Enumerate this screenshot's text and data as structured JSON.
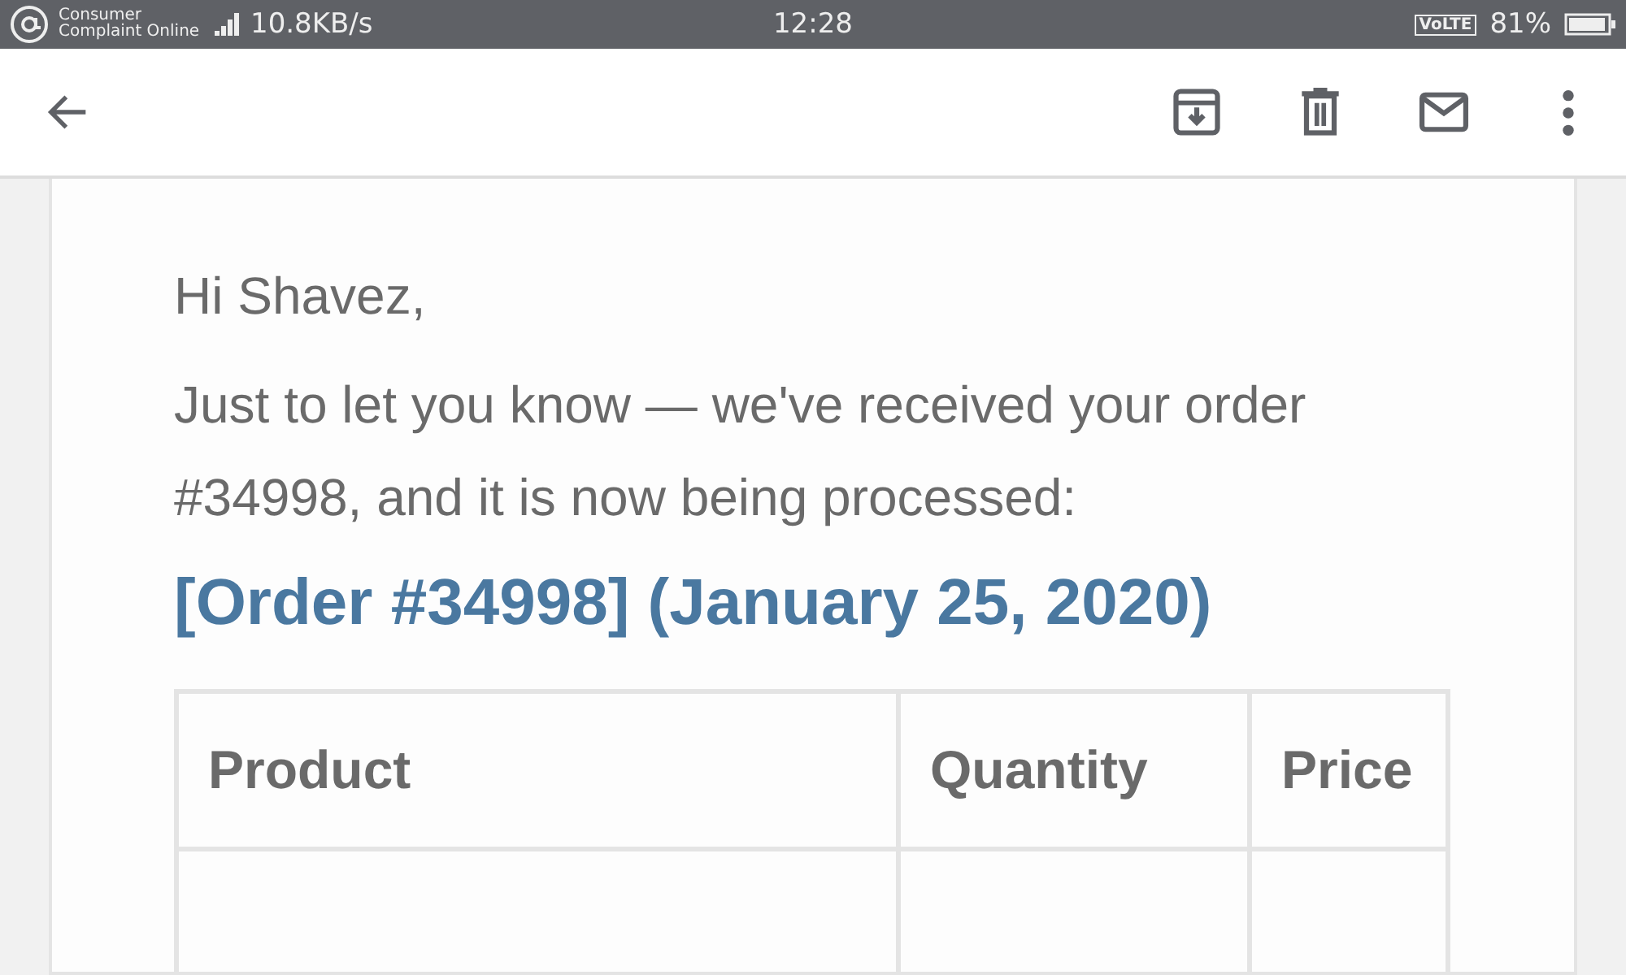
{
  "status_bar": {
    "notification": "Consumer Complaint Online",
    "network_speed": "10.8KB/s",
    "time": "12:28",
    "volte": "VoLTE",
    "battery": "81%"
  },
  "toolbar": {
    "actions": [
      {
        "kind": "archive"
      },
      {
        "kind": "delete"
      },
      {
        "kind": "mail"
      },
      {
        "kind": "more"
      }
    ]
  },
  "email": {
    "greeting": "Hi Shavez,",
    "message": "Just to let you know — we've received your order #34998, and it is now being processed:",
    "order_heading": "[Order #34998] (January 25, 2020)",
    "table": {
      "columns": [
        "Product",
        "Quantity",
        "Price"
      ],
      "rows": [
        [
          "",
          "",
          ""
        ]
      ]
    }
  }
}
